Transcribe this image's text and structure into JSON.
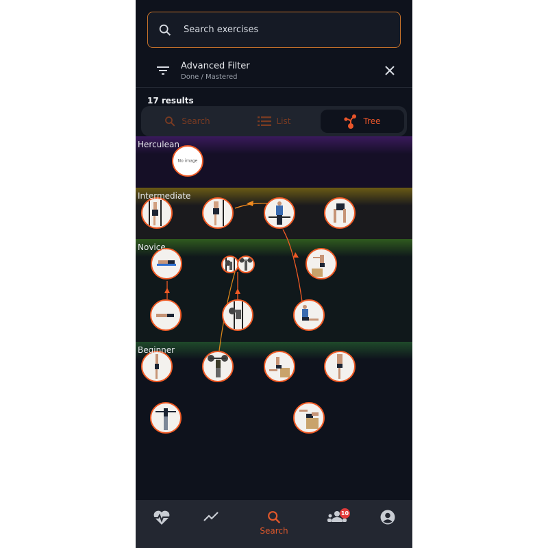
{
  "search": {
    "placeholder": "Search exercises",
    "value": ""
  },
  "filter": {
    "title": "Advanced Filter",
    "subtitle": "Done / Mastered"
  },
  "results_label": "17 results",
  "view_toggle": [
    {
      "label": "Search",
      "icon": "search-icon",
      "active": false
    },
    {
      "label": "List",
      "icon": "list-icon",
      "active": false
    },
    {
      "label": "Tree",
      "icon": "tree-icon",
      "active": true
    }
  ],
  "levels": [
    {
      "label": "Herculean",
      "color": "#3a1a5c"
    },
    {
      "label": "Intermediate",
      "color": "#6a5a14"
    },
    {
      "label": "Novice",
      "color": "#2f5a1e"
    },
    {
      "label": "Beginner",
      "color": "#1f4a2a"
    }
  ],
  "no_image_text": "No image",
  "nav": {
    "items": [
      {
        "name": "heart-rate-icon",
        "label": ""
      },
      {
        "name": "progress-chart-icon",
        "label": ""
      },
      {
        "name": "search-icon",
        "label": "Search",
        "active": true
      },
      {
        "name": "community-icon",
        "label": "",
        "badge": "10"
      },
      {
        "name": "profile-icon",
        "label": ""
      }
    ]
  },
  "colors": {
    "accent": "#ee5a25",
    "background": "#0e121c"
  }
}
